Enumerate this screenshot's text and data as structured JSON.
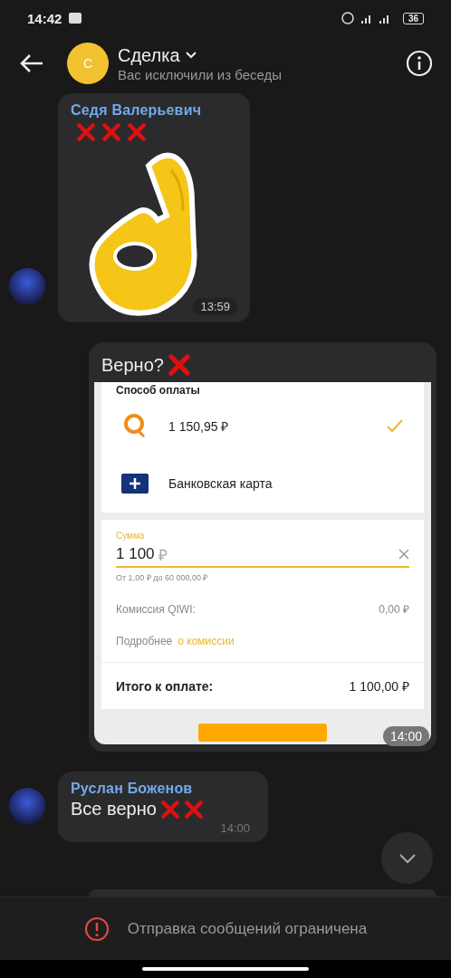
{
  "status_bar": {
    "time": "14:42",
    "battery": "36"
  },
  "header": {
    "avatar_letter": "С",
    "title": "Сделка",
    "subtitle": "Вас исключили из беседы"
  },
  "messages": [
    {
      "kind": "sticker",
      "sender": "Седя Валерьевич",
      "time": "13:59"
    },
    {
      "kind": "screenshot",
      "text": "Верно?",
      "time": "14:00",
      "screenshot": {
        "section_title": "Способ оплаты",
        "methods": [
          {
            "kind": "qiwi",
            "label": "1 150,95 ₽",
            "selected": true
          },
          {
            "kind": "card",
            "label": "Банковская карта",
            "selected": false
          }
        ],
        "amount": {
          "label": "Сумма",
          "value": "1 100",
          "currency": "₽",
          "hint": "От 1,00 ₽ до 60 000,00 ₽"
        },
        "commission": {
          "label": "Комиссия QIWI:",
          "value": "0,00 ₽"
        },
        "details": {
          "text": "Подробнее",
          "link": "о комиссии"
        },
        "total": {
          "label": "Итого к оплате:",
          "value": "1 100,00 ₽"
        }
      }
    },
    {
      "kind": "text",
      "sender": "Руслан Боженов",
      "text": "Все верно",
      "time": "14:00"
    }
  ],
  "composer": {
    "notice": "Отправка сообщений ограничена"
  }
}
